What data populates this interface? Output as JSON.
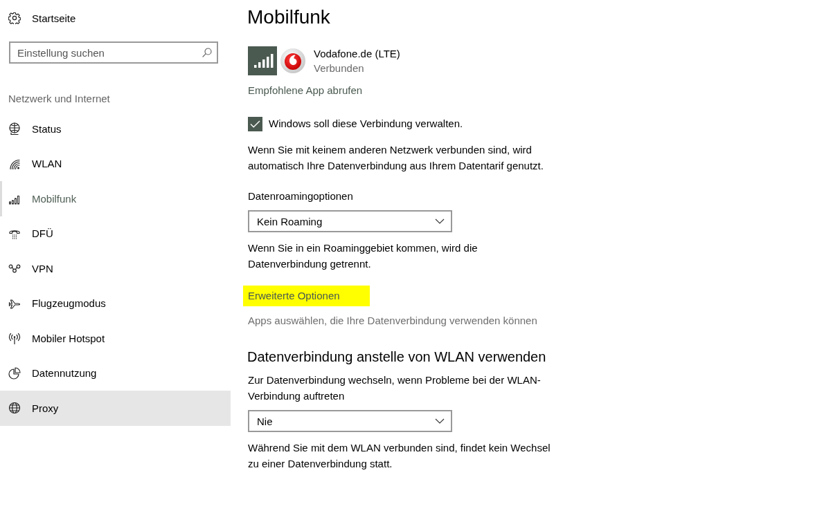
{
  "sidebar": {
    "home": {
      "label": "Startseite"
    },
    "search": {
      "placeholder": "Einstellung suchen"
    },
    "section_title": "Netzwerk und Internet",
    "items": [
      {
        "label": "Status",
        "selected": false,
        "hovered": false
      },
      {
        "label": "WLAN",
        "selected": false,
        "hovered": false
      },
      {
        "label": "Mobilfunk",
        "selected": true,
        "hovered": false
      },
      {
        "label": "DFÜ",
        "selected": false,
        "hovered": false
      },
      {
        "label": "VPN",
        "selected": false,
        "hovered": false
      },
      {
        "label": "Flugzeugmodus",
        "selected": false,
        "hovered": false
      },
      {
        "label": "Mobiler Hotspot",
        "selected": false,
        "hovered": false
      },
      {
        "label": "Datennutzung",
        "selected": false,
        "hovered": false
      },
      {
        "label": "Proxy",
        "selected": false,
        "hovered": true
      }
    ]
  },
  "page": {
    "title": "Mobilfunk",
    "connection": {
      "name": "Vodafone.de (LTE)",
      "status": "Verbunden"
    },
    "app_link": "Empfohlene App abrufen",
    "manage_checkbox": {
      "label": "Windows soll diese Verbindung verwalten.",
      "checked": true
    },
    "manage_description": "Wenn Sie mit keinem anderen Netzwerk verbunden sind, wird automatisch Ihre Datenverbindung aus Ihrem Datentarif genutzt.",
    "roaming": {
      "label": "Datenroamingoptionen",
      "value": "Kein Roaming",
      "description": "Wenn Sie in ein Roaminggebiet kommen, wird die Datenverbindung getrennt."
    },
    "advanced_link": {
      "label": "Erweiterte Optionen",
      "highlighted": true
    },
    "apps_hint": "Apps auswählen, die Ihre Datenverbindung verwenden können",
    "wlan_section": {
      "title": "Datenverbindung anstelle von WLAN verwenden",
      "label": "Zur Datenverbindung wechseln, wenn Probleme bei der WLAN-Verbindung auftreten",
      "value": "Nie",
      "description": "Während Sie mit dem WLAN verbunden sind, findet kein Wechsel zu einer Datenverbindung statt."
    }
  }
}
